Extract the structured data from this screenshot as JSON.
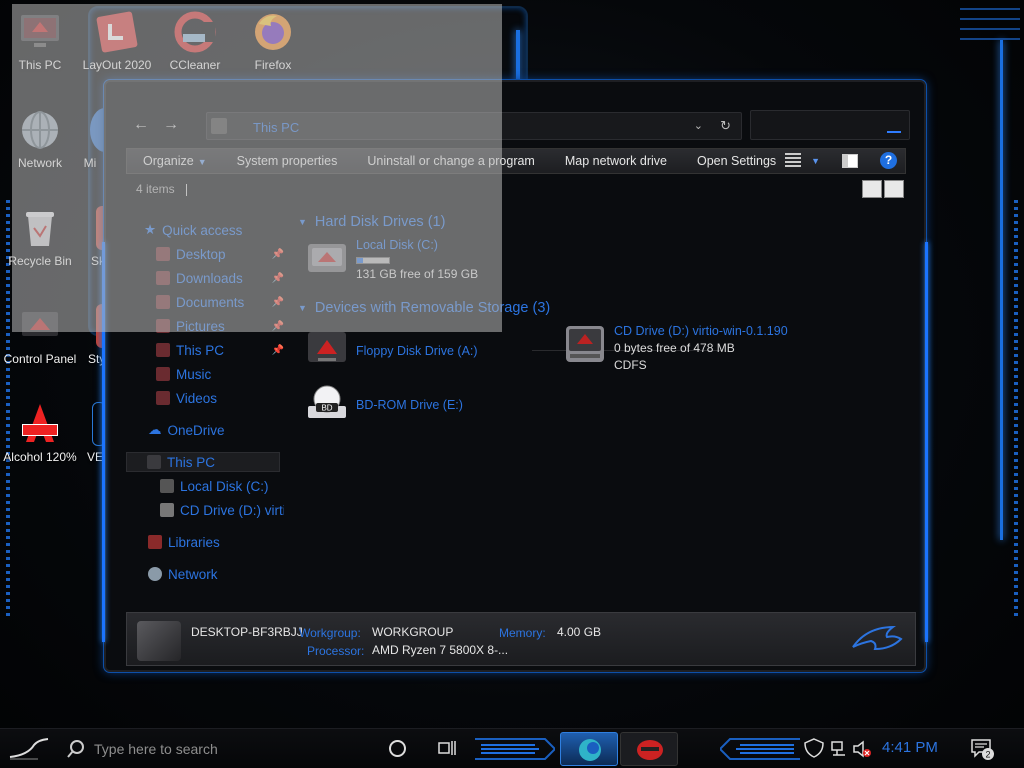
{
  "colors": {
    "accent": "#2c74e0",
    "glow": "#1b74ff",
    "bg": "#0a0c0f"
  },
  "desktop": {
    "icons": [
      {
        "label": "This PC",
        "icon": "this-pc-icon"
      },
      {
        "label": "LayOut 2020",
        "icon": "layout-icon"
      },
      {
        "label": "CCleaner",
        "icon": "ccleaner-icon"
      },
      {
        "label": "Firefox",
        "icon": "firefox-icon"
      },
      {
        "label": "Network",
        "icon": "network-icon"
      },
      {
        "label": "Mi",
        "icon": "app-icon"
      },
      {
        "label": "Recycle Bin",
        "icon": "recycle-bin-icon"
      },
      {
        "label": "Sk",
        "icon": "app-icon"
      },
      {
        "label": "Control Panel",
        "icon": "control-panel-icon"
      },
      {
        "label": "Styl",
        "icon": "app-icon"
      },
      {
        "label": "Alcohol 120%",
        "icon": "alcohol-icon"
      },
      {
        "label": "VE",
        "icon": "app-icon"
      }
    ]
  },
  "explorer": {
    "address": "This PC",
    "toolbar": {
      "organize": "Organize",
      "system_properties": "System properties",
      "uninstall": "Uninstall or change a program",
      "map_drive": "Map network drive",
      "open_settings": "Open Settings"
    },
    "item_count": "4 items",
    "nav": {
      "quick_access": "Quick access",
      "desktop": "Desktop",
      "downloads": "Downloads",
      "documents": "Documents",
      "pictures": "Pictures",
      "this_pc_pinned": "This PC",
      "music": "Music",
      "videos": "Videos",
      "onedrive": "OneDrive",
      "this_pc": "This PC",
      "local_disk": "Local Disk (C:)",
      "cd_drive": "CD Drive (D:) virtio",
      "libraries": "Libraries",
      "network": "Network"
    },
    "groups": {
      "hdd": "Hard Disk Drives (1)",
      "removable": "Devices with Removable Storage (3)"
    },
    "drives": {
      "c": {
        "name": "Local Disk (C:)",
        "free": "131 GB free of 159 GB",
        "used_fraction": 0.18
      },
      "d": {
        "name": "CD Drive (D:) virtio-win-0.1.190",
        "free": "0 bytes free of 478 MB",
        "fs": "CDFS"
      },
      "a": {
        "name": "Floppy Disk Drive (A:)"
      },
      "e": {
        "name": "BD-ROM Drive (E:)",
        "badge": "BD"
      }
    },
    "details": {
      "computer_name": "DESKTOP-BF3RBJJ",
      "workgroup_label": "Workgroup:",
      "workgroup": "WORKGROUP",
      "memory_label": "Memory:",
      "memory": "4.00 GB",
      "processor_label": "Processor:",
      "processor": "AMD Ryzen 7 5800X 8-..."
    }
  },
  "taskbar": {
    "search_placeholder": "Type here to search",
    "clock": "4:41 PM",
    "notifications": "2"
  }
}
